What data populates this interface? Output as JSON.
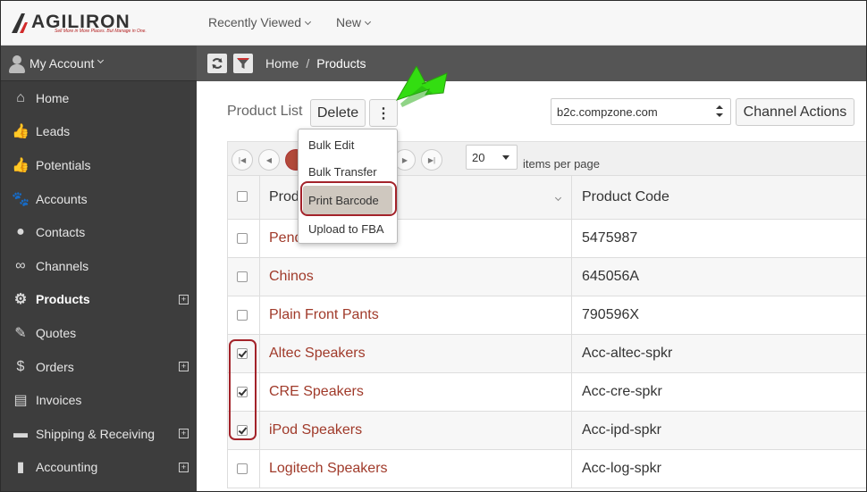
{
  "brand": {
    "wordmark": "AGILIRON",
    "tagline": "Sell More in More Places. But Manage in One.",
    "accent": "#d22a2a"
  },
  "topnav": {
    "recently_viewed": "Recently Viewed",
    "new": "New"
  },
  "sidebar": {
    "account": "My Account",
    "items": [
      {
        "label": "Home",
        "icon": "home-icon",
        "expandable": false,
        "active": false
      },
      {
        "label": "Leads",
        "icon": "thumbs-up-outline-icon",
        "expandable": false,
        "active": false
      },
      {
        "label": "Potentials",
        "icon": "thumbs-up-icon",
        "expandable": false,
        "active": false
      },
      {
        "label": "Accounts",
        "icon": "paw-icon",
        "expandable": false,
        "active": false
      },
      {
        "label": "Contacts",
        "icon": "user-icon",
        "expandable": false,
        "active": false
      },
      {
        "label": "Channels",
        "icon": "link-icon",
        "expandable": false,
        "active": false
      },
      {
        "label": "Products",
        "icon": "gears-icon",
        "expandable": true,
        "active": true
      },
      {
        "label": "Quotes",
        "icon": "edit-icon",
        "expandable": false,
        "active": false
      },
      {
        "label": "Orders",
        "icon": "dollar-icon",
        "expandable": true,
        "active": false
      },
      {
        "label": "Invoices",
        "icon": "document-icon",
        "expandable": false,
        "active": false
      },
      {
        "label": "Shipping & Receiving",
        "icon": "truck-icon",
        "expandable": true,
        "active": false
      },
      {
        "label": "Accounting",
        "icon": "book-icon",
        "expandable": true,
        "active": false
      }
    ]
  },
  "breadcrumb": {
    "home": "Home",
    "separator": "/",
    "current": "Products"
  },
  "toolbar": {
    "list_label": "Product List",
    "delete": "Delete",
    "more_icon": "⋮",
    "channel": "b2c.compzone.com",
    "channel_actions": "Channel Actions"
  },
  "pager": {
    "page_size": "20",
    "items_per_page": "items per page"
  },
  "menu": {
    "items": [
      "Bulk Edit",
      "Bulk Transfer",
      "Print Barcode",
      "Upload to FBA"
    ]
  },
  "table": {
    "columns": [
      "Product Name",
      "Product Code"
    ],
    "rows": [
      {
        "name": "Pendant",
        "code": "5475987",
        "checked": false
      },
      {
        "name": "Chinos",
        "code": "645056A",
        "checked": false
      },
      {
        "name": "Plain Front Pants",
        "code": "790596X",
        "checked": false
      },
      {
        "name": "Altec Speakers",
        "code": "Acc-altec-spkr",
        "checked": true
      },
      {
        "name": "CRE Speakers",
        "code": "Acc-cre-spkr",
        "checked": true
      },
      {
        "name": "iPod Speakers",
        "code": "Acc-ipd-spkr",
        "checked": true
      },
      {
        "name": "Logitech Speakers",
        "code": "Acc-log-spkr",
        "checked": false
      }
    ]
  },
  "colors": {
    "sidebar_bg": "#3d3d3d",
    "link_red": "#a03a2a",
    "highlight_ring": "#a3232a",
    "arrow_green": "#33dd11"
  }
}
